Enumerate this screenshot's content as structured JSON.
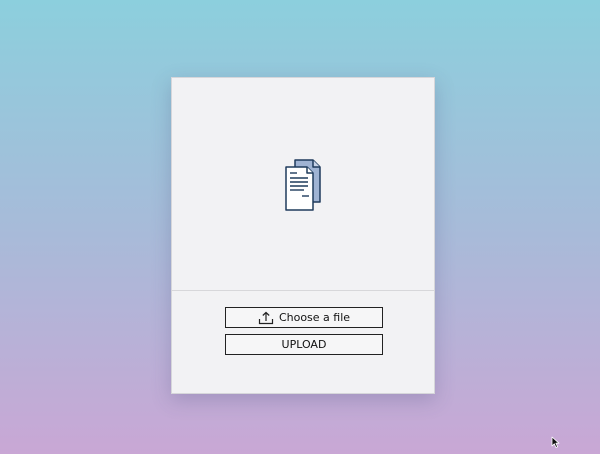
{
  "upload_panel": {
    "choose_label": "Choose a file",
    "upload_label": "UPLOAD"
  },
  "icons": {
    "preview": "documents-icon",
    "choose": "upload-arrow-icon",
    "cursor": "mouse-pointer-icon"
  },
  "colors": {
    "background_top": "#8ccfdd",
    "background_bottom": "#c9a7d5",
    "panel": "#f2f2f4",
    "icon_stroke": "#1f3b5c",
    "icon_fill": "#9fb3d3"
  }
}
